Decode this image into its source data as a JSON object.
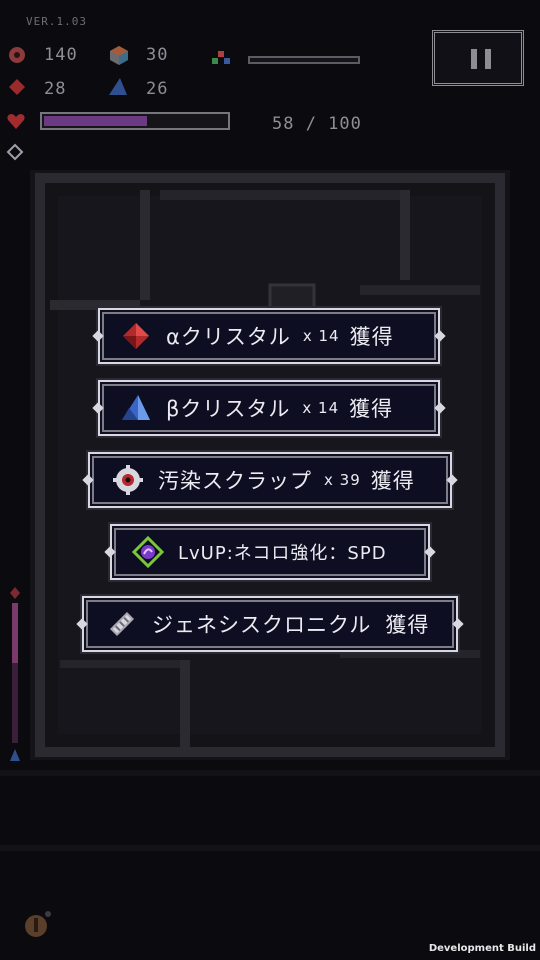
{
  "version": "VER.1.03",
  "stats": {
    "scrap_count": "140",
    "cube_count": "30",
    "alpha_count": "28",
    "beta_count": "26"
  },
  "hp": {
    "current_text": "58 / 100",
    "fraction": 0.58
  },
  "rewards": [
    {
      "icon": "red-crystal-icon",
      "label": "αクリスタル",
      "mult": "x 14",
      "suffix": "獲得"
    },
    {
      "icon": "blue-crystal-icon",
      "label": "βクリスタル",
      "mult": "x 14",
      "suffix": "獲得"
    },
    {
      "icon": "scrap-gear-icon",
      "label": "汚染スクラップ",
      "mult": "x 39",
      "suffix": "獲得"
    },
    {
      "icon": "levelup-icon",
      "label": "LvUP:ネコロ強化：SPD",
      "mult": "",
      "suffix": ""
    },
    {
      "icon": "chronicle-icon",
      "label": "ジェネシスクロニクル",
      "mult": "",
      "suffix": "獲得"
    }
  ],
  "dev_build": "Development Build",
  "colors": {
    "hp_fill": "#6b3a82",
    "panel_bg": "#0d0e22",
    "panel_border": "#d9d7df"
  }
}
